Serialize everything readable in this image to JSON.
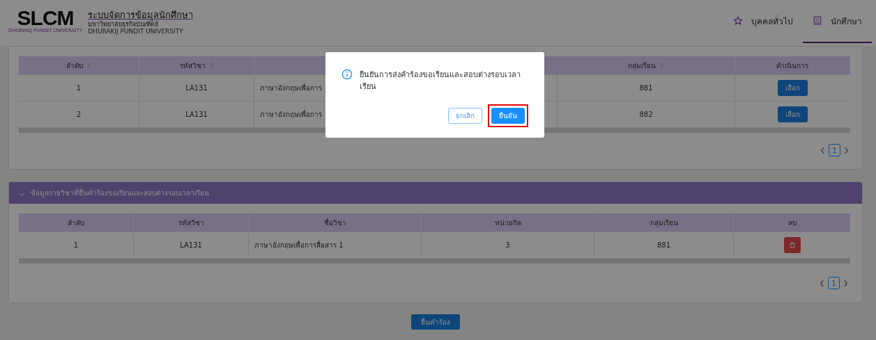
{
  "header": {
    "logo": "SLCM",
    "logo_caption": "DHURAKIJ PUNDIT UNIVERSITY",
    "title": "ระบบจัดการข้อมูลนักศึกษา",
    "subtitle_th": "มหาวิทยาลัยธุรกิจบัณฑิตย์",
    "subtitle_en": "DHURAKIJ PUNDIT UNIVERSITY",
    "nav": [
      {
        "label": "บุคคลทั่วไป",
        "selected": false
      },
      {
        "label": "นักศึกษา",
        "selected": true
      }
    ]
  },
  "course_table": {
    "columns": [
      {
        "label": "ลำดับ",
        "sortable": true
      },
      {
        "label": "รหัสวิชา",
        "sortable": true
      },
      {
        "label": "กลุ่มเรียน",
        "sortable": true
      },
      {
        "label": "ดำเนินการ",
        "sortable": false
      }
    ],
    "rows": [
      {
        "no": "1",
        "code": "LA131",
        "name": "ภาษาอังกฤษเพื่อการ",
        "group": "881",
        "action": "เลือก"
      },
      {
        "no": "2",
        "code": "LA131",
        "name": "ภาษาอังกฤษเพื่อการ",
        "group": "882",
        "action": "เลือก"
      }
    ],
    "page": "1"
  },
  "request_section": {
    "title": "ข้อมูลรายวิชาที่ยื่นคำร้องขอเรียนและสอบต่างรอบเวลาเรียน",
    "expanded": true,
    "columns": [
      "ลำดับ",
      "รหัสวิชา",
      "ชื่อวิชา",
      "หน่วยกิต",
      "กลุ่มเรียน",
      "ลบ"
    ],
    "rows": [
      {
        "no": "1",
        "code": "LA131",
        "name": "ภาษาอังกฤษเพื่อการสื่อสาร 1",
        "credits": "3",
        "group": "881"
      }
    ],
    "page": "1"
  },
  "submit_button": "ยื่นคำร้อง",
  "dialog": {
    "message": "ยืนยันการส่งคำร้องขอเรียนและสอบต่างรอบเวลาเรียน",
    "buttons": [
      {
        "label": "ยกเลิก",
        "kind": "secondary",
        "highlighted": false
      },
      {
        "label": "ยืนยัน",
        "kind": "primary",
        "highlighted": true
      }
    ]
  }
}
